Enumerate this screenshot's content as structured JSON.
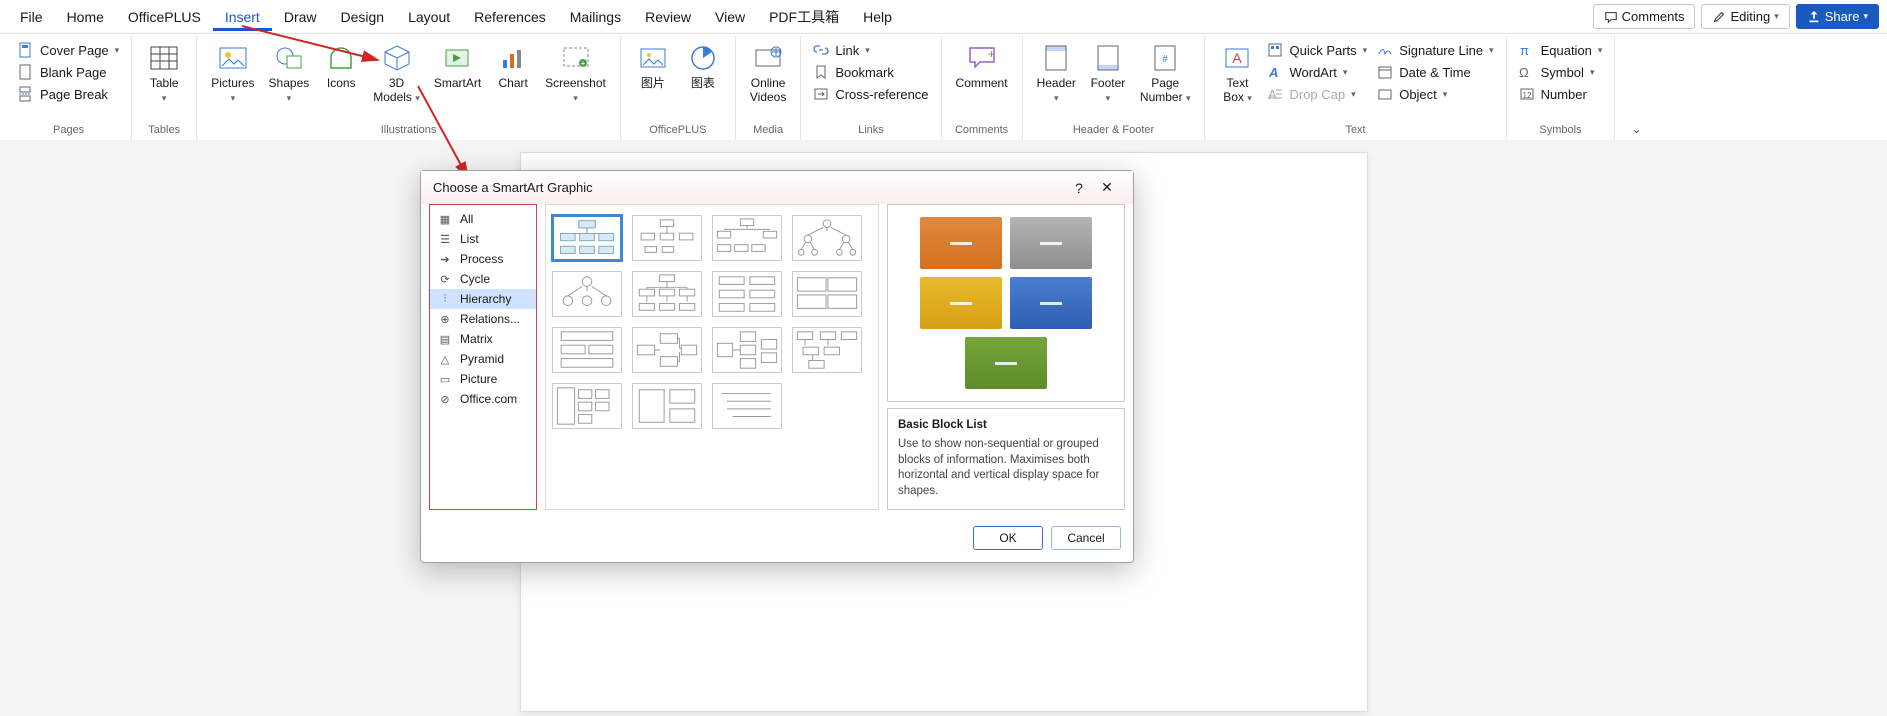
{
  "menus": {
    "file": "File",
    "home": "Home",
    "officeplus": "OfficePLUS",
    "insert": "Insert",
    "draw": "Draw",
    "design": "Design",
    "layout": "Layout",
    "references": "References",
    "mailings": "Mailings",
    "review": "Review",
    "view": "View",
    "pdf": "PDF工具箱",
    "help": "Help"
  },
  "topright": {
    "comments": "Comments",
    "editing": "Editing",
    "share": "Share"
  },
  "groups": {
    "pages": "Pages",
    "tables": "Tables",
    "illustrations": "Illustrations",
    "officeplus": "OfficePLUS",
    "media": "Media",
    "links": "Links",
    "comments": "Comments",
    "headerfooter": "Header & Footer",
    "text": "Text",
    "symbols": "Symbols"
  },
  "btn": {
    "coverpage": "Cover Page",
    "blankpage": "Blank Page",
    "pagebreak": "Page Break",
    "table": "Table",
    "pictures": "Pictures",
    "shapes": "Shapes",
    "icons": "Icons",
    "models": "3D\nModels",
    "smartart": "SmartArt",
    "chart": "Chart",
    "screenshot": "Screenshot",
    "tupian": "图片",
    "tubiao": "图表",
    "onlinevideos": "Online\nVideos",
    "link": "Link",
    "bookmark": "Bookmark",
    "crossref": "Cross-reference",
    "comment": "Comment",
    "header": "Header",
    "footer": "Footer",
    "pagenumber": "Page\nNumber",
    "textbox": "Text\nBox",
    "quickparts": "Quick Parts",
    "wordart": "WordArt",
    "dropcap": "Drop Cap",
    "sigline": "Signature Line",
    "datetime": "Date & Time",
    "object": "Object",
    "equation": "Equation",
    "symbol": "Symbol",
    "number": "Number"
  },
  "dialog": {
    "title": "Choose a SmartArt Graphic",
    "cats": {
      "all": "All",
      "list": "List",
      "process": "Process",
      "cycle": "Cycle",
      "hierarchy": "Hierarchy",
      "relationship": "Relations...",
      "matrix": "Matrix",
      "pyramid": "Pyramid",
      "picture": "Picture",
      "office": "Office.com"
    },
    "preview_title": "Basic Block List",
    "preview_desc": "Use to show non-sequential or grouped blocks of information. Maximises both horizontal and vertical display space for shapes.",
    "ok": "OK",
    "cancel": "Cancel"
  }
}
